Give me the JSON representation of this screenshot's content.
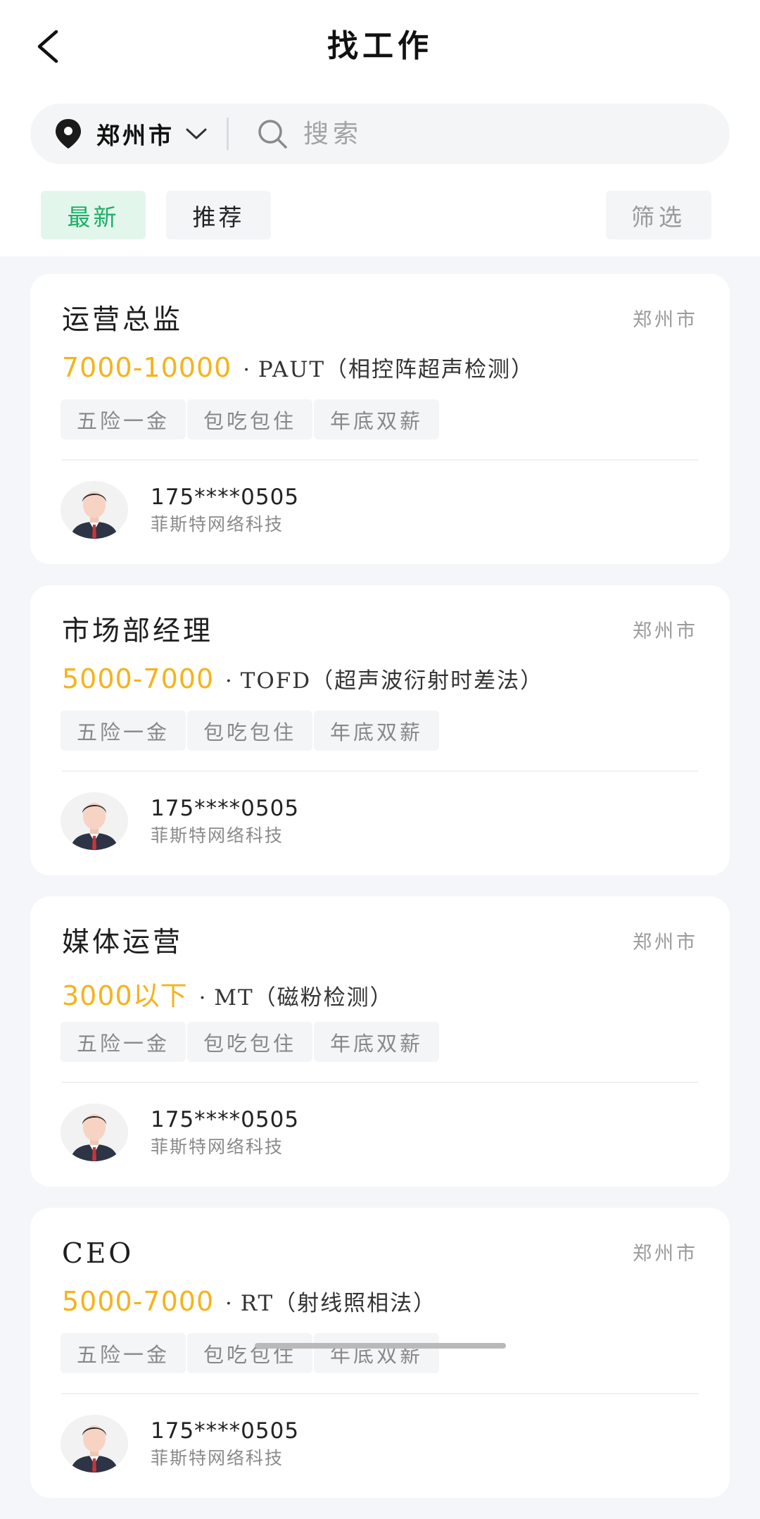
{
  "header": {
    "title": "找工作"
  },
  "search": {
    "city": "郑州市",
    "placeholder": "搜索"
  },
  "tabs": [
    {
      "label": "最新",
      "active": true
    },
    {
      "label": "推荐",
      "active": false
    }
  ],
  "filter_label": "筛选",
  "jobs": [
    {
      "title": "运营总监",
      "city": "郑州市",
      "salary": "7000-10000",
      "tech": "PAUT（相控阵超声检测）",
      "tags": [
        "五险一金",
        "包吃包住",
        "年底双薪"
      ],
      "phone": "175****0505",
      "company": "菲斯特网络科技"
    },
    {
      "title": "市场部经理",
      "city": "郑州市",
      "salary": "5000-7000",
      "tech": "TOFD（超声波衍射时差法）",
      "tags": [
        "五险一金",
        "包吃包住",
        "年底双薪"
      ],
      "phone": "175****0505",
      "company": "菲斯特网络科技"
    },
    {
      "title": "媒体运营",
      "city": "郑州市",
      "salary": "3000以下",
      "tech": "MT（磁粉检测）",
      "tags": [
        "五险一金",
        "包吃包住",
        "年底双薪"
      ],
      "phone": "175****0505",
      "company": "菲斯特网络科技"
    },
    {
      "title": "CEO",
      "city": "郑州市",
      "salary": "5000-7000",
      "tech": "RT（射线照相法）",
      "tags": [
        "五险一金",
        "包吃包住",
        "年底双薪"
      ],
      "phone": "175****0505",
      "company": "菲斯特网络科技"
    }
  ],
  "colors": {
    "accent_green": "#1db066",
    "salary_orange": "#f5b31c"
  },
  "icons": {
    "back": "chevron-left-icon",
    "location": "location-pin-icon",
    "dropdown": "chevron-down-icon",
    "search": "search-icon",
    "avatar": "businessman-avatar-icon"
  }
}
